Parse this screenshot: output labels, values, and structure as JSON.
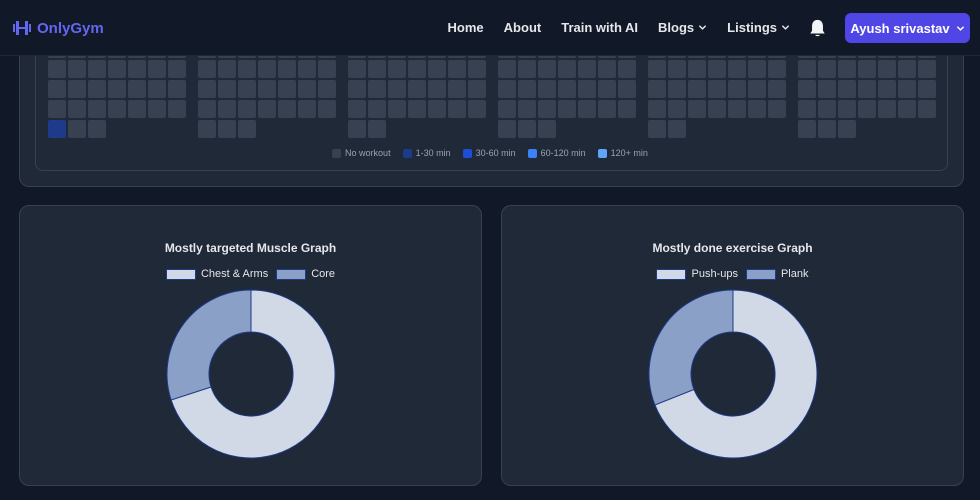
{
  "navbar": {
    "brand": "OnlyGym",
    "links": [
      {
        "label": "Home"
      },
      {
        "label": "About"
      },
      {
        "label": "Train with AI"
      },
      {
        "label": "Blogs",
        "dropdown": true
      },
      {
        "label": "Listings",
        "dropdown": true
      }
    ],
    "user_button": "Ayush srivastav",
    "icons": {
      "brand": "dumbbell-icon",
      "notifications": "bell-icon",
      "dropdown": "chevron-down-icon"
    }
  },
  "heatmap": {
    "legend": [
      {
        "label": "No workout",
        "color": "#374151"
      },
      {
        "label": "1-30 min",
        "color": "#1e3a8a"
      },
      {
        "label": "30-60 min",
        "color": "#1d4ed8"
      },
      {
        "label": "60-120 min",
        "color": "#3b82f6"
      },
      {
        "label": "120+ min",
        "color": "#60a5fa"
      }
    ],
    "months": [
      {
        "last_row_count": 3,
        "highlight": 0
      },
      {
        "last_row_count": 3
      },
      {
        "last_row_count": 2
      },
      {
        "last_row_count": 3
      },
      {
        "last_row_count": 2
      },
      {
        "last_row_count": 3
      }
    ]
  },
  "charts": [
    {
      "title": "Mostly targeted Muscle Graph",
      "legend": [
        {
          "label": "Chest & Arms",
          "color": "#d1d9e6"
        },
        {
          "label": "Core",
          "color": "#8aa0c6"
        }
      ],
      "chart_data": {
        "type": "pie",
        "title": "Mostly targeted Muscle Graph",
        "categories": [
          "Chest & Arms",
          "Core"
        ],
        "values": [
          70,
          30
        ],
        "colors": [
          "#d1d9e6",
          "#8aa0c6"
        ]
      }
    },
    {
      "title": "Mostly done exercise Graph",
      "legend": [
        {
          "label": "Push-ups",
          "color": "#d1d9e6"
        },
        {
          "label": "Plank",
          "color": "#8aa0c6"
        }
      ],
      "chart_data": {
        "type": "pie",
        "title": "Mostly done exercise Graph",
        "categories": [
          "Push-ups",
          "Plank"
        ],
        "values": [
          69,
          31
        ],
        "colors": [
          "#d1d9e6",
          "#8aa0c6"
        ]
      }
    }
  ],
  "colors": {
    "accent": "#4f46e5",
    "brand": "#6366f1",
    "background": "#111827",
    "card": "#1f2937"
  }
}
